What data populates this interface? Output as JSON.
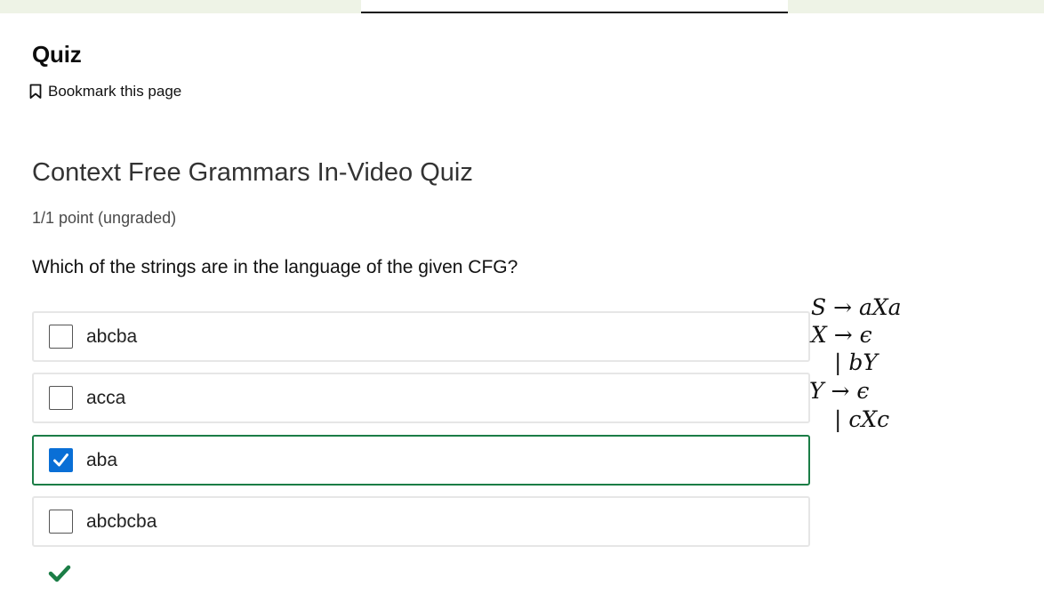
{
  "header": {
    "title": "Quiz",
    "bookmark_label": "Bookmark this page"
  },
  "problem": {
    "title": "Context Free Grammars In-Video Quiz",
    "points": "1/1 point (ungraded)",
    "question": "Which of the strings are in the language of the given CFG?",
    "choices": [
      {
        "label": "abcba",
        "checked": false
      },
      {
        "label": "acca",
        "checked": false
      },
      {
        "label": "aba",
        "checked": true
      },
      {
        "label": "abcbcba",
        "checked": false
      }
    ]
  },
  "grammar": {
    "lines": [
      "S → aXa",
      "X → ϵ",
      "| bY",
      "Y → ϵ",
      "| cXc"
    ]
  },
  "status": {
    "result_icon": "checkmark-icon",
    "result": "correct"
  },
  "colors": {
    "selected_border": "#1b7d46",
    "checkbox_checked": "#0a6fd6",
    "correct_check": "#1b7d46",
    "top_strip": "#eef3e6"
  }
}
